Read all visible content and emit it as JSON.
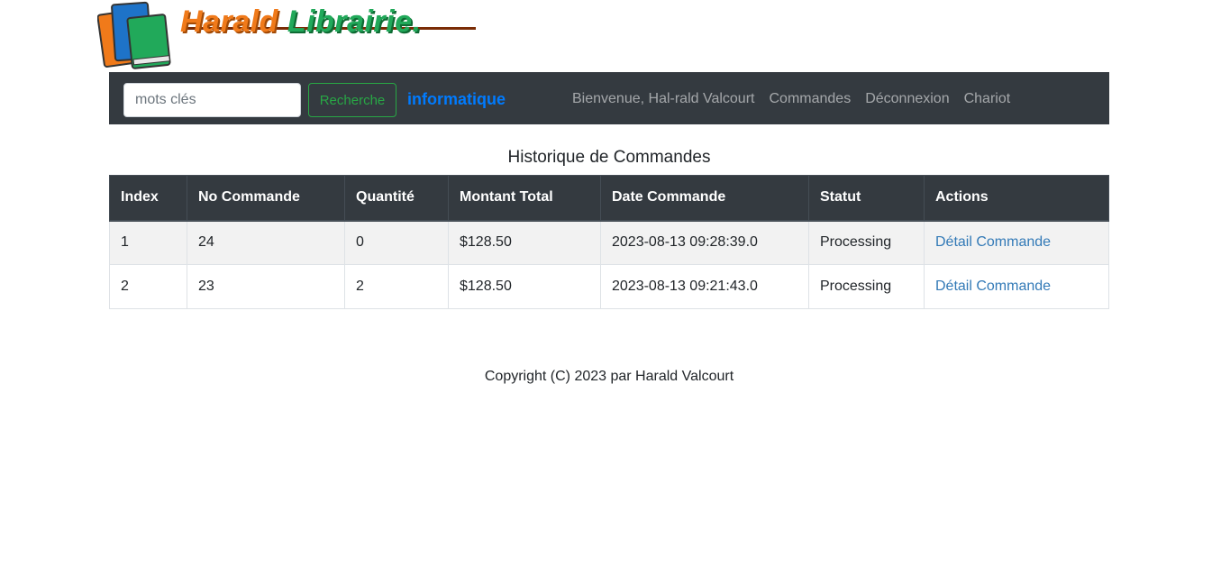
{
  "logo": {
    "text_part1": "Harald",
    "text_part2": "Librairie.",
    "icon": "books-icon",
    "colors": {
      "orange": "#f07a1a",
      "green": "#21a95a",
      "blue": "#1e73c8"
    }
  },
  "navbar": {
    "search_placeholder": "mots clés",
    "search_button": "Recherche",
    "brand": "informatique",
    "links": [
      {
        "label": "Bienvenue, Hal-rald Valcourt"
      },
      {
        "label": "Commandes"
      },
      {
        "label": "Déconnexion"
      },
      {
        "label": "Chariot"
      }
    ]
  },
  "page": {
    "title": "Historique de Commandes"
  },
  "table": {
    "headers": [
      "Index",
      "No Commande",
      "Quantité",
      "Montant Total",
      "Date Commande",
      "Statut",
      "Actions"
    ],
    "rows": [
      {
        "index": "1",
        "order_no": "24",
        "quantity": "0",
        "total": "$128.50",
        "date": "2023-08-13 09:28:39.0",
        "status": "Processing",
        "action": "Détail Commande"
      },
      {
        "index": "2",
        "order_no": "23",
        "quantity": "2",
        "total": "$128.50",
        "date": "2023-08-13 09:21:43.0",
        "status": "Processing",
        "action": "Détail Commande"
      }
    ]
  },
  "footer": {
    "copyright": "Copyright (C) 2023 par Harald Valcourt"
  }
}
